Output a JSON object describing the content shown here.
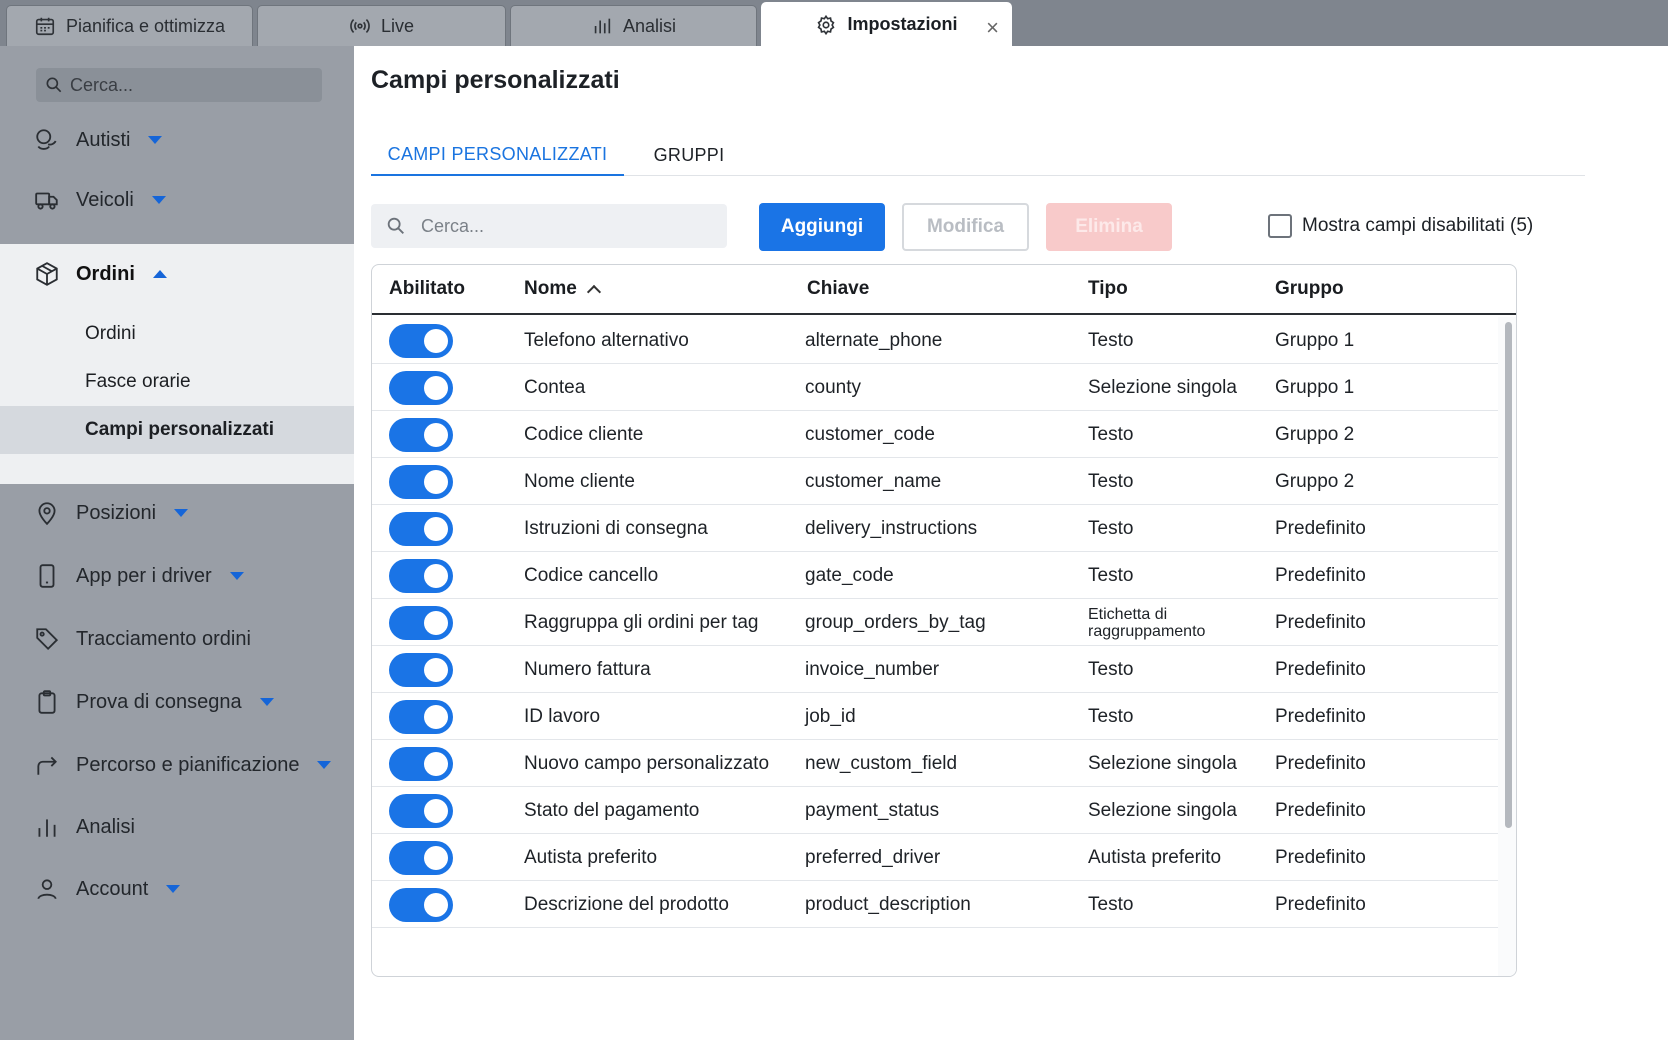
{
  "tabs": [
    {
      "label": "Pianifica e ottimizza",
      "icon": "calendar-icon"
    },
    {
      "label": "Live",
      "icon": "broadcast-icon"
    },
    {
      "label": "Analisi",
      "icon": "bar-chart-icon"
    },
    {
      "label": "Impostazioni",
      "icon": "gear-icon",
      "active": true,
      "close": "×"
    }
  ],
  "sidebar": {
    "search_placeholder": "Cerca...",
    "items": [
      {
        "label": "Autisti",
        "icon": "drivers-icon",
        "expandable": true
      },
      {
        "label": "Veicoli",
        "icon": "truck-icon",
        "expandable": true
      },
      {
        "label": "Ordini",
        "icon": "box-icon",
        "expanded": true
      },
      {
        "label": "Posizioni",
        "icon": "location-pin-icon",
        "expandable": true
      },
      {
        "label": "App per i driver",
        "icon": "phone-icon",
        "expandable": true
      },
      {
        "label": "Tracciamento ordini",
        "icon": "tag-icon"
      },
      {
        "label": "Prova di consegna",
        "icon": "clipboard-icon",
        "expandable": true
      },
      {
        "label": "Percorso e pianificazione",
        "icon": "route-arrow-icon",
        "expandable": true
      },
      {
        "label": "Analisi",
        "icon": "bar-chart-icon"
      },
      {
        "label": "Account",
        "icon": "user-icon",
        "expandable": true
      }
    ],
    "subitems": [
      {
        "label": "Ordini"
      },
      {
        "label": "Fasce orarie"
      },
      {
        "label": "Campi personalizzati",
        "active": true
      }
    ]
  },
  "main": {
    "title": "Campi personalizzati",
    "subtabs": [
      {
        "label": "CAMPI PERSONALIZZATI",
        "active": true
      },
      {
        "label": "GRUPPI"
      }
    ],
    "search_placeholder": "Cerca...",
    "buttons": {
      "add": "Aggiungi",
      "edit": "Modifica",
      "delete": "Elimina"
    },
    "show_disabled_label": "Mostra campi disabilitati (5)",
    "show_disabled_checked": false,
    "accent_color": "#1a74e6"
  },
  "table": {
    "columns": [
      "Abilitato",
      "Nome",
      "Chiave",
      "Tipo",
      "Gruppo"
    ],
    "sort": {
      "column": "Nome",
      "direction": "asc"
    },
    "rows": [
      {
        "enabled": true,
        "name": "Telefono alternativo",
        "key": "alternate_phone",
        "type": "Testo",
        "group": "Gruppo 1"
      },
      {
        "enabled": true,
        "name": "Contea",
        "key": "county",
        "type": "Selezione singola",
        "group": "Gruppo 1"
      },
      {
        "enabled": true,
        "name": "Codice cliente",
        "key": "customer_code",
        "type": "Testo",
        "group": "Gruppo 2"
      },
      {
        "enabled": true,
        "name": "Nome cliente",
        "key": "customer_name",
        "type": "Testo",
        "group": "Gruppo 2"
      },
      {
        "enabled": true,
        "name": "Istruzioni di consegna",
        "key": "delivery_instructions",
        "type": "Testo",
        "group": "Predefinito"
      },
      {
        "enabled": true,
        "name": "Codice cancello",
        "key": "gate_code",
        "type": "Testo",
        "group": "Predefinito"
      },
      {
        "enabled": true,
        "name": "Raggruppa gli ordini per tag",
        "key": "group_orders_by_tag",
        "type": "Etichetta di raggruppamento",
        "group": "Predefinito"
      },
      {
        "enabled": true,
        "name": "Numero fattura",
        "key": "invoice_number",
        "type": "Testo",
        "group": "Predefinito"
      },
      {
        "enabled": true,
        "name": "ID lavoro",
        "key": "job_id",
        "type": "Testo",
        "group": "Predefinito"
      },
      {
        "enabled": true,
        "name": "Nuovo campo personalizzato",
        "key": "new_custom_field",
        "type": "Selezione singola",
        "group": "Predefinito"
      },
      {
        "enabled": true,
        "name": "Stato del pagamento",
        "key": "payment_status",
        "type": "Selezione singola",
        "group": "Predefinito"
      },
      {
        "enabled": true,
        "name": "Autista preferito",
        "key": "preferred_driver",
        "type": "Autista preferito",
        "group": "Predefinito"
      },
      {
        "enabled": true,
        "name": "Descrizione del prodotto",
        "key": "product_description",
        "type": "Testo",
        "group": "Predefinito"
      }
    ]
  }
}
